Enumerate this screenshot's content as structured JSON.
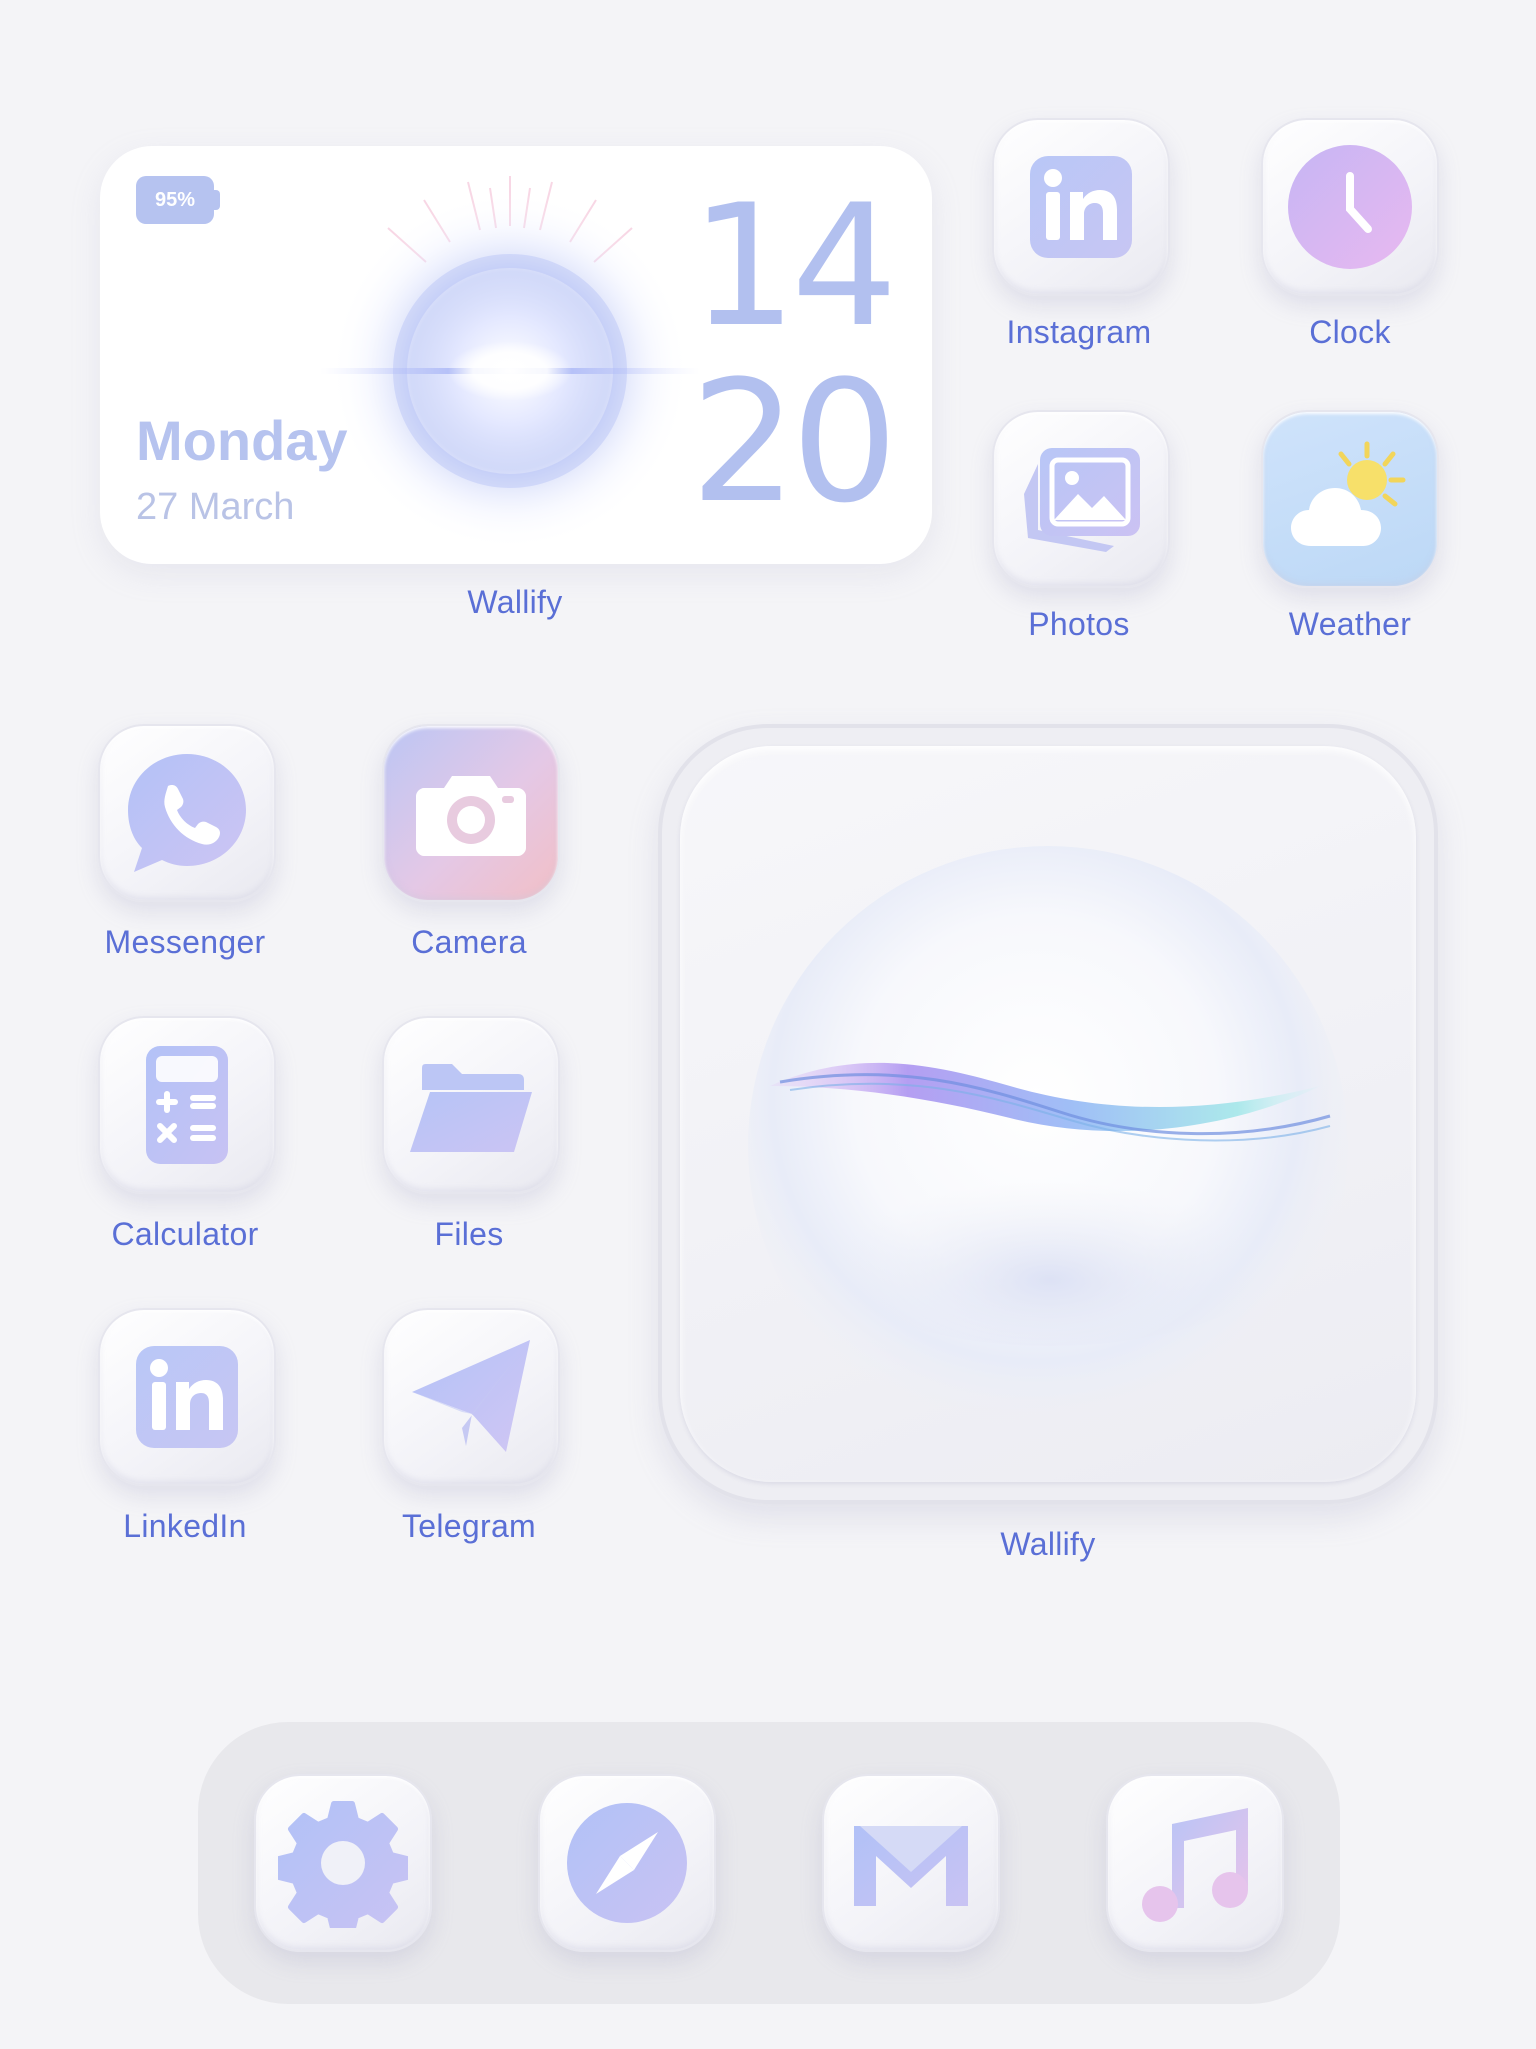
{
  "clock_widget": {
    "battery": "95%",
    "hour": "14",
    "minute": "20",
    "day": "Monday",
    "date": "27 March",
    "label": "Wallify"
  },
  "big_widget": {
    "label": "Wallify"
  },
  "apps": {
    "instagram": {
      "label": "Instagram",
      "icon": "linkedin-in-icon"
    },
    "clock": {
      "label": "Clock",
      "icon": "clock-icon"
    },
    "photos": {
      "label": "Photos",
      "icon": "photos-icon"
    },
    "weather": {
      "label": "Weather",
      "icon": "weather-icon"
    },
    "messenger": {
      "label": "Messenger",
      "icon": "phone-bubble-icon"
    },
    "camera": {
      "label": "Camera",
      "icon": "camera-icon"
    },
    "calculator": {
      "label": "Calculator",
      "icon": "calculator-icon"
    },
    "files": {
      "label": "Files",
      "icon": "folder-icon"
    },
    "linkedin": {
      "label": "LinkedIn",
      "icon": "linkedin-icon"
    },
    "telegram": {
      "label": "Telegram",
      "icon": "paper-plane-icon"
    }
  },
  "dock": [
    {
      "icon": "settings-gear-icon"
    },
    {
      "icon": "compass-icon"
    },
    {
      "icon": "mail-icon"
    },
    {
      "icon": "music-note-icon"
    }
  ],
  "colors": {
    "background": "#f4f4f7",
    "label": "#5a6fd6",
    "accent": "#b2c0ef"
  }
}
